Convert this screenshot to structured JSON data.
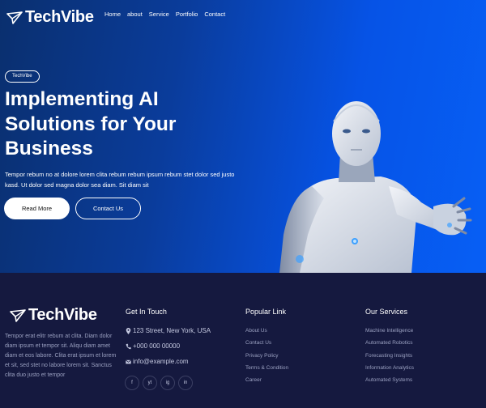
{
  "brand": {
    "name": "TechVibe"
  },
  "nav": [
    "Home",
    "about",
    "Service",
    "Portfolio",
    "Contact"
  ],
  "hero": {
    "badge": "TechVibe",
    "title": "Implementing AI Solutions for Your Business",
    "text": "Tempor rebum no at dolore lorem clita rebum rebum ipsum rebum stet dolor sed justo kasd. Ut dolor sed magna dolor sea diam. Sit diam sit",
    "primary_button": "Read More",
    "secondary_button": "Contact Us"
  },
  "footer": {
    "about_text": "Tempor erat elitr rebum at clita. Diam dolor diam ipsum et tempor sit. Aliqu diam amet diam et eos labore. Clita erat ipsum et lorem et sit, sed stet no labore lorem sit. Sanctus clita duo justo et tempor",
    "get_in_touch": {
      "title": "Get In Touch",
      "address": "123 Street, New York, USA",
      "phone": "+000 000 00000",
      "email": "info@example.com"
    },
    "popular_links": {
      "title": "Popular Link",
      "items": [
        "About Us",
        "Contact Us",
        "Privacy Policy",
        "Terms & Condition",
        "Career"
      ]
    },
    "services": {
      "title": "Our Services",
      "items": [
        "Machine Intelligence",
        "Automated Robotics",
        "Forecasting Insights",
        "Information Analytics",
        "Automated Systems"
      ]
    },
    "social": [
      "f",
      "yt",
      "ig",
      "in"
    ]
  },
  "colors": {
    "hero_start": "#0a2f6e",
    "hero_end": "#075ff5",
    "footer_bg": "#15193f"
  }
}
